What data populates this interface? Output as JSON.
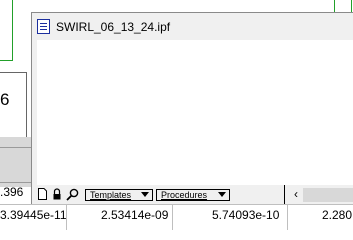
{
  "background": {
    "big_digit": "6",
    "row_top": ".396",
    "table_row": [
      "3.39445e-11",
      "2.53414e-09",
      "5.74093e-10",
      "2.280"
    ]
  },
  "procedure_window": {
    "title": "SWIRL_06_13_24.ipf",
    "templates_label": "Templates",
    "procedures_label": "Procedures",
    "scroll_left_glyph": "‹"
  },
  "colors": {
    "graph_line": "#22a02a",
    "icon_blue": "#1c2f9e",
    "window_bg": "#f0f0f0"
  }
}
